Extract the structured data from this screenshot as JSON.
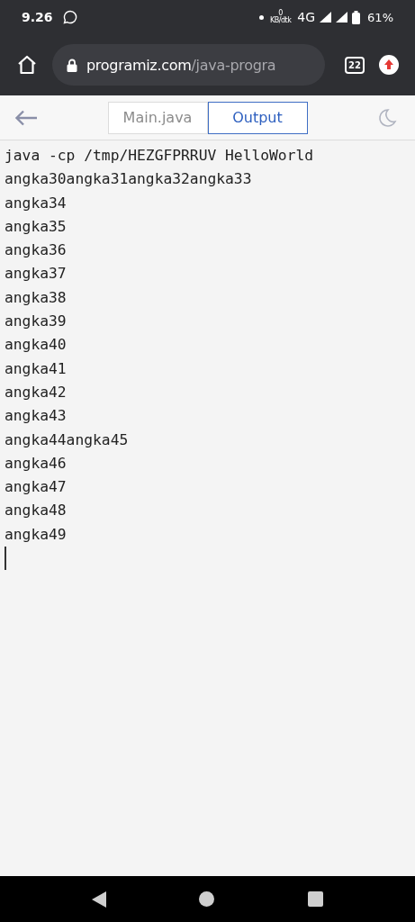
{
  "status_bar": {
    "time": "9.26",
    "data_speed_value": "0",
    "data_speed_unit": "KB/dtk",
    "network": "4G",
    "battery": "61%"
  },
  "browser": {
    "url_domain": "programiz.com",
    "url_path": "/java-progra",
    "tab_count": "22"
  },
  "tabs": [
    {
      "label": "Main.java",
      "selected": false
    },
    {
      "label": "Output",
      "selected": true
    }
  ],
  "output": {
    "lines": [
      "java -cp /tmp/HEZGFPRRUV HelloWorld",
      "angka30angka31angka32angka33",
      "angka34",
      "angka35",
      "angka36",
      "angka37",
      "angka38",
      "angka39",
      "angka40",
      "angka41",
      "angka42",
      "angka43",
      "angka44angka45",
      "angka46",
      "angka47",
      "angka48",
      "angka49"
    ]
  }
}
